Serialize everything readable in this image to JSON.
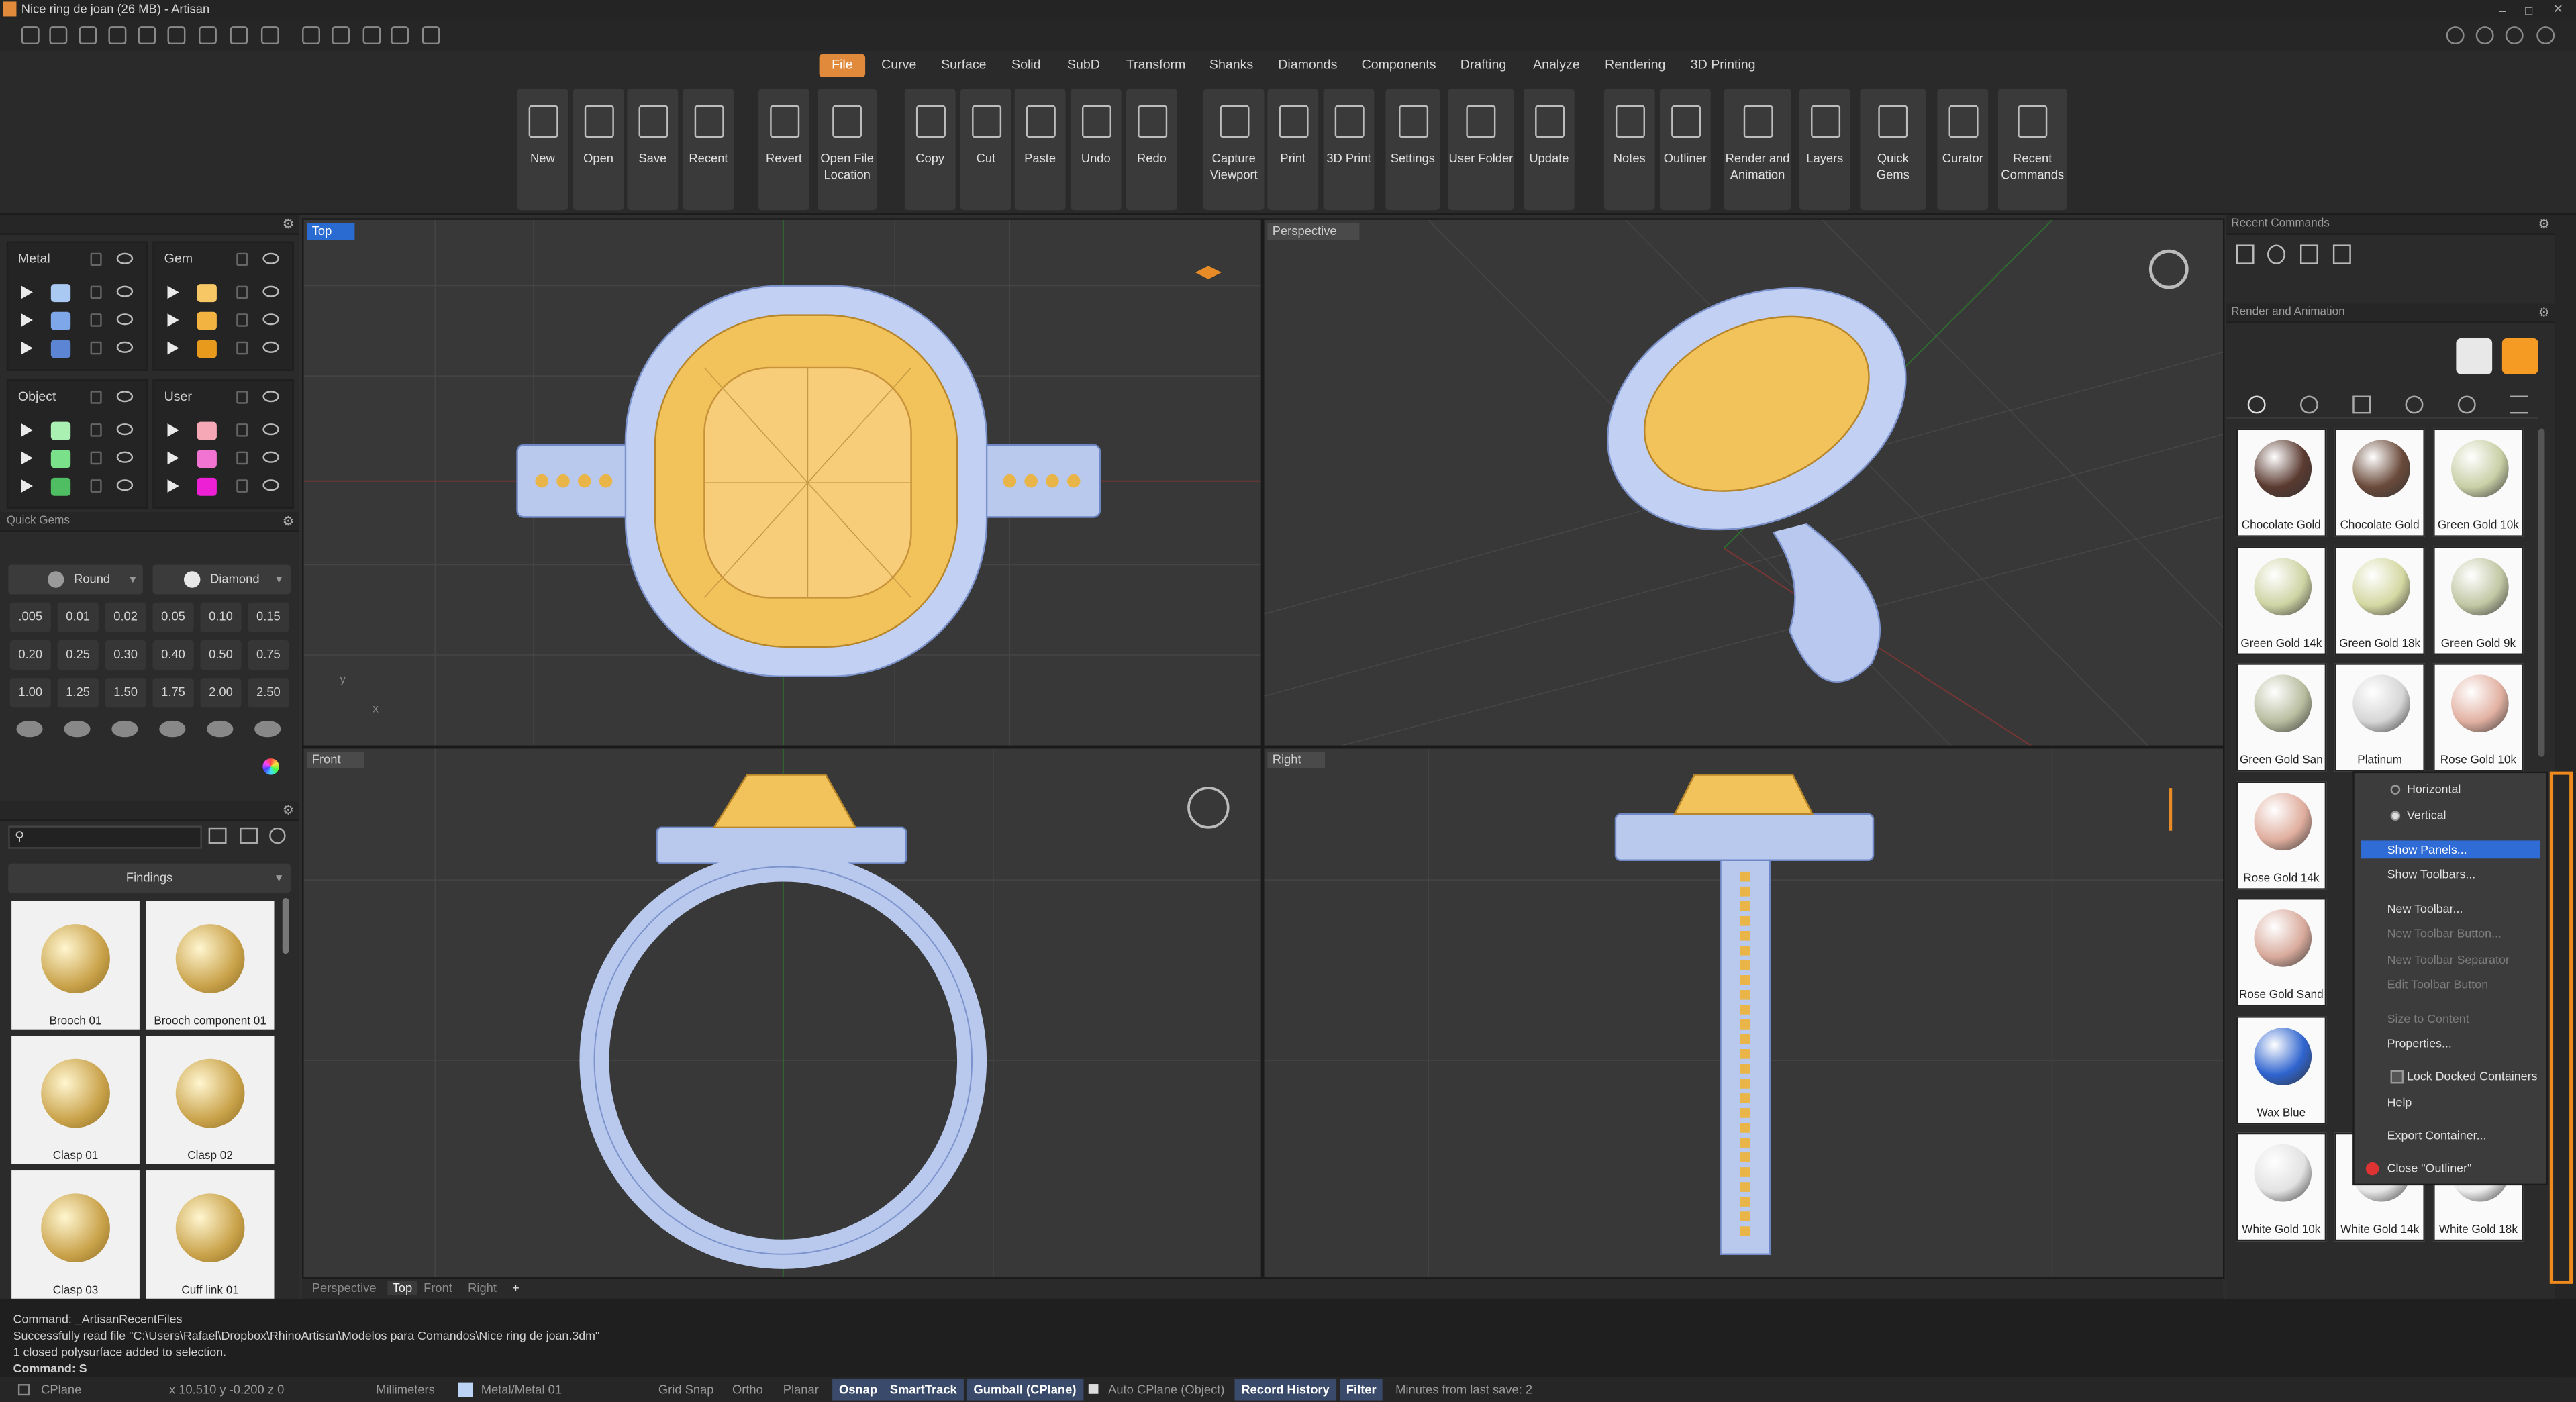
{
  "app": {
    "title": "Nice ring de joan (26 MB) - Artisan"
  },
  "tabs": [
    "File",
    "Curve",
    "Surface",
    "Solid",
    "SubD",
    "Transform",
    "Shanks",
    "Diamonds",
    "Components",
    "Drafting",
    "Analyze",
    "Rendering",
    "3D Printing"
  ],
  "ribbon": [
    {
      "l1": "New",
      "l2": ""
    },
    {
      "l1": "Open",
      "l2": ""
    },
    {
      "l1": "Save",
      "l2": ""
    },
    {
      "l1": "Recent",
      "l2": ""
    },
    {
      "l1": "Revert",
      "l2": ""
    },
    {
      "l1": "Open File",
      "l2": "Location"
    },
    {
      "l1": "Copy",
      "l2": ""
    },
    {
      "l1": "Cut",
      "l2": ""
    },
    {
      "l1": "Paste",
      "l2": ""
    },
    {
      "l1": "Undo",
      "l2": ""
    },
    {
      "l1": "Redo",
      "l2": ""
    },
    {
      "l1": "Capture",
      "l2": "Viewport"
    },
    {
      "l1": "Print",
      "l2": ""
    },
    {
      "l1": "3D Print",
      "l2": ""
    },
    {
      "l1": "Settings",
      "l2": ""
    },
    {
      "l1": "User Folder",
      "l2": ""
    },
    {
      "l1": "Update",
      "l2": ""
    },
    {
      "l1": "Notes",
      "l2": ""
    },
    {
      "l1": "Outliner",
      "l2": ""
    },
    {
      "l1": "Render and",
      "l2": "Animation"
    },
    {
      "l1": "Layers",
      "l2": ""
    },
    {
      "l1": "Quick Gems",
      "l2": ""
    },
    {
      "l1": "Curator",
      "l2": ""
    },
    {
      "l1": "Recent",
      "l2": "Commands"
    }
  ],
  "layers": {
    "groups": [
      {
        "name": "Metal",
        "colors": [
          "#a9c8f2",
          "#7ea7ea",
          "#5c86d3"
        ]
      },
      {
        "name": "Gem",
        "colors": [
          "#f7c766",
          "#f2b340",
          "#e89a1c"
        ]
      },
      {
        "name": "Object",
        "colors": [
          "#a9f0b2",
          "#7be08a",
          "#4fbe63"
        ]
      },
      {
        "name": "User",
        "colors": [
          "#f6a8b6",
          "#f274d2",
          "#ee20d6"
        ]
      }
    ]
  },
  "quick_gems": {
    "title": "Quick Gems",
    "shape": "Round",
    "material": "Diamond",
    "sizes": [
      ".005",
      "0.01",
      "0.02",
      "0.05",
      "0.10",
      "0.15",
      "0.20",
      "0.25",
      "0.30",
      "0.40",
      "0.50",
      "0.75",
      "1.00",
      "1.25",
      "1.50",
      "1.75",
      "2.00",
      "2.50"
    ]
  },
  "library": {
    "category": "Findings",
    "items": [
      "Brooch 01",
      "Brooch component 01",
      "Clasp 01",
      "Clasp 02",
      "Clasp 03",
      "Cuff link 01"
    ]
  },
  "viewports": {
    "top": "Top",
    "perspective": "Perspective",
    "front": "Front",
    "right": "Right"
  },
  "viewport_tabs": [
    "Perspective",
    "Top",
    "Front",
    "Right",
    "+"
  ],
  "recent_commands": {
    "title": "Recent Commands"
  },
  "render": {
    "title": "Render and Animation",
    "materials": [
      {
        "name": "Chocolate Gold",
        "color": "#5a3a30"
      },
      {
        "name": "Chocolate Gold",
        "color": "#6a4a3a"
      },
      {
        "name": "Green Gold 10k",
        "color": "#c9cfa6"
      },
      {
        "name": "Green Gold 14k",
        "color": "#cfd4a4"
      },
      {
        "name": "Green Gold 18k",
        "color": "#d4d8a2"
      },
      {
        "name": "Green Gold 9k",
        "color": "#c2c7a4"
      },
      {
        "name": "Green Gold San",
        "color": "#b9bea0"
      },
      {
        "name": "Platinum",
        "color": "#d6d6d6"
      },
      {
        "name": "Rose Gold 10k",
        "color": "#e2b1a2"
      },
      {
        "name": "Rose Gold 14k",
        "color": "#e0ae9e"
      },
      {
        "name": "Rose Gold Sand",
        "color": "#d9ab9d"
      },
      {
        "name": "Wax Blue",
        "color": "#2f64cf"
      },
      {
        "name": "White Gold 10k",
        "color": "#e2e2e2"
      },
      {
        "name": "White Gold 14k",
        "color": "#e6e6e6"
      },
      {
        "name": "White Gold 18k",
        "color": "#ececec"
      }
    ]
  },
  "context_menu": {
    "items": [
      {
        "label": "Horizontal",
        "state": "radio"
      },
      {
        "label": "Vertical",
        "state": "radio-on"
      },
      {
        "label": "Show Panels...",
        "state": "sel"
      },
      {
        "label": "Show Toolbars...",
        "state": ""
      },
      {
        "label": "New Toolbar...",
        "state": ""
      },
      {
        "label": "New Toolbar Button...",
        "state": "dis"
      },
      {
        "label": "New Toolbar Separator",
        "state": "dis"
      },
      {
        "label": "Edit Toolbar Button",
        "state": "dis"
      },
      {
        "label": "Size to Content",
        "state": "dis"
      },
      {
        "label": "Properties...",
        "state": ""
      },
      {
        "label": "Lock Docked Containers",
        "state": "check"
      },
      {
        "label": "Help",
        "state": ""
      },
      {
        "label": "Export Container...",
        "state": ""
      },
      {
        "label": "Close \"Outliner\"",
        "state": "close"
      }
    ]
  },
  "command_history": [
    "Command: _ArtisanRecentFiles",
    "Successfully read file \"C:\\Users\\Rafael\\Dropbox\\RhinoArtisan\\Modelos para Comandos\\Nice ring de joan.3dm\"",
    "1 closed polysurface added to selection."
  ],
  "command_prompt": {
    "label": "Command:",
    "value": "S"
  },
  "status": {
    "cplane": "CPlane",
    "coords": "x 10.510  y -0.200  z 0",
    "units": "Millimeters",
    "layer": "Metal/Metal 01",
    "grid_snap": "Grid Snap",
    "ortho": "Ortho",
    "planar": "Planar",
    "osnap": "Osnap",
    "smarttrack": "SmartTrack",
    "gumball": "Gumball (CPlane)",
    "auto_cplane": "Auto CPlane (Object)",
    "record_history": "Record History",
    "filter": "Filter",
    "minutes": "Minutes from last save: 2"
  }
}
